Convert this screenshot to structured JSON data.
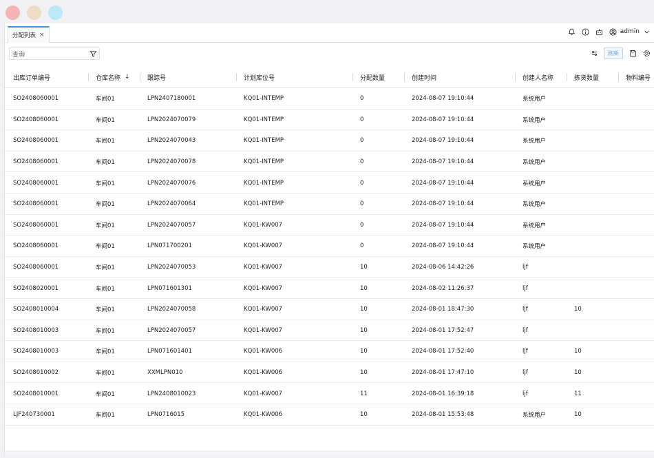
{
  "tab": {
    "label": "分配列表",
    "close": "×"
  },
  "user": {
    "name": "admin"
  },
  "toolbar": {
    "search_placeholder": "查询",
    "refresh_label": "刷新"
  },
  "table": {
    "columns": [
      "出库订单编号",
      "仓库名称",
      "跟踪号",
      "计划库位号",
      "分配数量",
      "创建时间",
      "创建人名称",
      "拣货数量",
      "物料编号"
    ],
    "sort_indicator": "↓",
    "rows": [
      [
        "SO2408060001",
        "车间01",
        "LPN2407180001",
        "KQ01-INTEMP",
        "0",
        "2024-08-07 19:10:44",
        "系统用户",
        ""
      ],
      [
        "SO2408060001",
        "车间01",
        "LPN2024070079",
        "KQ01-INTEMP",
        "0",
        "2024-08-07 19:10:44",
        "系统用户",
        ""
      ],
      [
        "SO2408060001",
        "车间01",
        "LPN2024070043",
        "KQ01-INTEMP",
        "0",
        "2024-08-07 19:10:44",
        "系统用户",
        ""
      ],
      [
        "SO2408060001",
        "车间01",
        "LPN2024070078",
        "KQ01-INTEMP",
        "0",
        "2024-08-07 19:10:44",
        "系统用户",
        ""
      ],
      [
        "SO2408060001",
        "车间01",
        "LPN2024070076",
        "KQ01-INTEMP",
        "0",
        "2024-08-07 19:10:44",
        "系统用户",
        ""
      ],
      [
        "SO2408060001",
        "车间01",
        "LPN2024070064",
        "KQ01-INTEMP",
        "0",
        "2024-08-07 19:10:44",
        "系统用户",
        ""
      ],
      [
        "SO2408060001",
        "车间01",
        "LPN2024070057",
        "KQ01-KW007",
        "0",
        "2024-08-07 19:10:44",
        "系统用户",
        ""
      ],
      [
        "SO2408060001",
        "车间01",
        "LPN071700201",
        "KQ01-KW007",
        "0",
        "2024-08-07 19:10:44",
        "系统用户",
        ""
      ],
      [
        "SO2408060001",
        "车间01",
        "LPN2024070053",
        "KQ01-KW007",
        "10",
        "2024-08-06 14:42:26",
        "ljf",
        ""
      ],
      [
        "SO2408020001",
        "车间01",
        "LPN071601301",
        "KQ01-KW007",
        "10",
        "2024-08-02 11:26:37",
        "ljf",
        ""
      ],
      [
        "SO2408010004",
        "车间01",
        "LPN2024070058",
        "KQ01-KW007",
        "10",
        "2024-08-01 18:47:30",
        "ljf",
        "10"
      ],
      [
        "SO2408010003",
        "车间01",
        "LPN2024070057",
        "KQ01-KW007",
        "10",
        "2024-08-01 17:52:47",
        "ljf",
        ""
      ],
      [
        "SO2408010003",
        "车间01",
        "LPN071601401",
        "KQ01-KW006",
        "10",
        "2024-08-01 17:52:40",
        "ljf",
        "10"
      ],
      [
        "SO2408010002",
        "车间01",
        "XXMLPN010",
        "KQ01-KW006",
        "10",
        "2024-08-01 17:47:10",
        "ljf",
        "10"
      ],
      [
        "SO2408010001",
        "车间01",
        "LPN2408010023",
        "KQ01-KW007",
        "11",
        "2024-08-01 16:39:18",
        "ljf",
        "11"
      ],
      [
        "LJF240730001",
        "车间01",
        "LPN0716015",
        "KQ01-KW006",
        "10",
        "2024-08-01 15:53:48",
        "系统用户",
        "10"
      ]
    ]
  }
}
